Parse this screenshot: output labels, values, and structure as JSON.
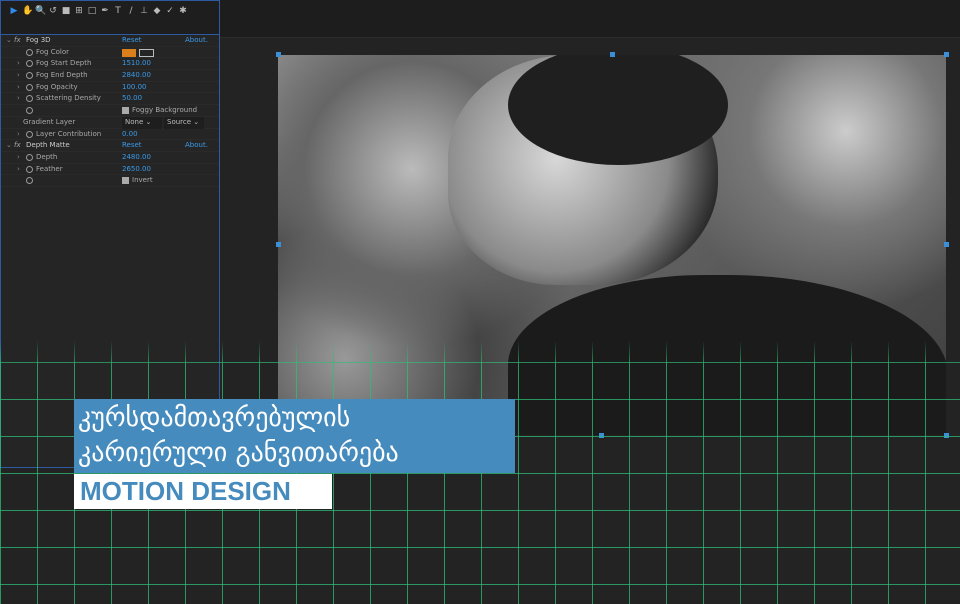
{
  "toolbar": {
    "tools": [
      "selection-tool",
      "hand-tool",
      "zoom-tool",
      "rotate-tool",
      "camera-tool",
      "pan-behind-tool",
      "rectangle-tool",
      "pen-tool",
      "type-tool",
      "brush-tool",
      "clone-stamp-tool",
      "eraser-tool",
      "roto-brush-tool",
      "puppet-tool"
    ],
    "glyphs": [
      "▶",
      "✋",
      "🔍",
      "↺",
      "■",
      "⊞",
      "□",
      "✒",
      "T",
      "/",
      "⊥",
      "◆",
      "✓",
      "✱"
    ]
  },
  "effects": {
    "fog3d": {
      "name": "Fog 3D",
      "reset": "Reset",
      "about": "About.",
      "fog_color_label": "Fog Color",
      "fog_color": "#d9801c",
      "props": [
        {
          "label": "Fog Start Depth",
          "value": "1510.00"
        },
        {
          "label": "Fog End Depth",
          "value": "2840.00"
        },
        {
          "label": "Fog Opacity",
          "value": "100.00"
        },
        {
          "label": "Scattering Density",
          "value": "50.00"
        }
      ],
      "foggy_background": "Foggy Background",
      "gradient_layer_label": "Gradient Layer",
      "gradient_layer_value": "None",
      "gradient_source_value": "Source",
      "layer_contribution_label": "Layer Contribution",
      "layer_contribution_value": "0.00"
    },
    "depth_matte": {
      "name": "Depth Matte",
      "reset": "Reset",
      "about": "About.",
      "props": [
        {
          "label": "Depth",
          "value": "2480.00"
        },
        {
          "label": "Feather",
          "value": "2650.00"
        }
      ],
      "invert": "Invert"
    }
  },
  "overlay": {
    "title_line1": "კურსდამთავრებულის",
    "title_line2": "კარიერული განვითარება",
    "subtitle": "MOTION DESIGN",
    "accent": "#458bbd",
    "grid_color": "#2ebe78"
  }
}
